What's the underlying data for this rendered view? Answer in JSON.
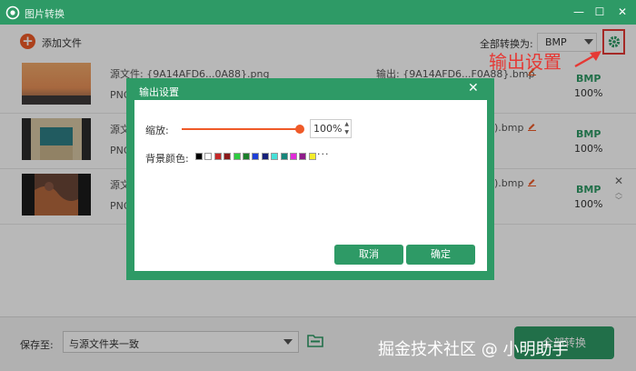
{
  "window": {
    "title": "图片转换",
    "title_bg": "#2e9a66"
  },
  "toolbar": {
    "add_label": "添加文件",
    "convert_all_label": "全部转换为:",
    "format_value": "BMP",
    "settings_icon": "gear-icon"
  },
  "annotation": {
    "text": "输出设置",
    "color": "#e53935"
  },
  "files": [
    {
      "src_name": "源文件: {9A14AFD6...0A88}.png",
      "src_format": "PNG",
      "out_name": "输出: {9A14AFD6...F0A88}.bmp",
      "out_format": "BMP",
      "out_pct": "100%"
    },
    {
      "src_name": "源文",
      "src_format": "PNG",
      "out_name": ").bmp",
      "out_format": "BMP",
      "out_pct": "100%"
    },
    {
      "src_name": "源文",
      "src_format": "PNG",
      "out_name": ").bmp",
      "out_format": "BMP",
      "out_pct": "100%"
    }
  ],
  "dialog": {
    "title": "输出设置",
    "scale_label": "缩放:",
    "scale_value": "100%",
    "scale_level": 1.0,
    "bg_color_label": "背景颜色:",
    "bg_colors": [
      "#000000",
      "#ffffff",
      "#c62828",
      "#8b1a1a",
      "#2ecc40",
      "#1b7f2a",
      "#1e3fd8",
      "#16207a",
      "#46e0d8",
      "#16857a",
      "#e02ad8",
      "#8e1a8a",
      "#f5ec2a"
    ],
    "more_label": "···",
    "cancel_label": "取消",
    "ok_label": "确定"
  },
  "bottom": {
    "save_to_label": "保存至:",
    "save_location": "与源文件夹一致",
    "convert_label": "全部转换"
  },
  "watermark": "掘金技术社区 @ 小明助手",
  "colors": {
    "accent": "#2e9a66",
    "orange": "#ef5a28",
    "red": "#e53935"
  }
}
